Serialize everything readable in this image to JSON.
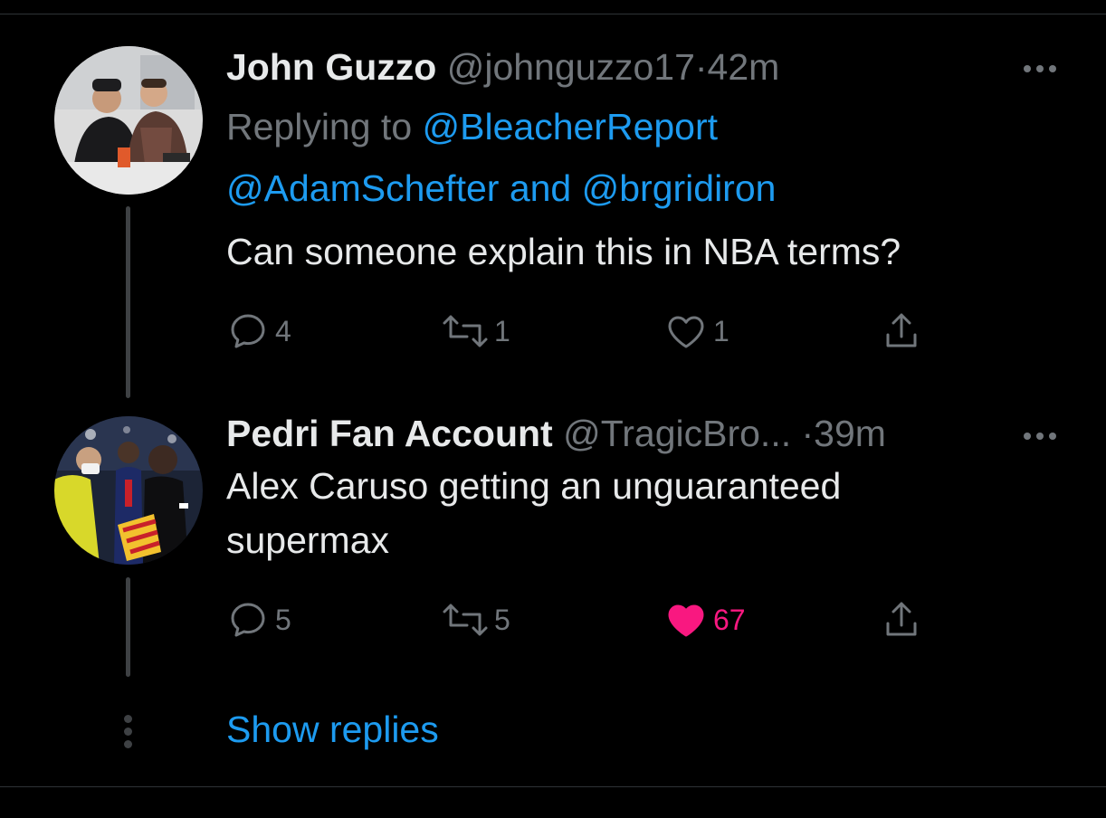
{
  "tweets": [
    {
      "name": "John Guzzo",
      "handle": "@johnguzzo17",
      "sep": "·",
      "time": "42m",
      "replying_prefix": "Replying to ",
      "replying_to_1": "@BleacherReport",
      "replying_to_2": "@AdamSchefter",
      "replying_and": " and ",
      "replying_to_3": "@brgridiron",
      "text": "Can someone explain this in NBA terms?",
      "replies": "4",
      "retweets": "1",
      "likes": "1",
      "liked": false
    },
    {
      "name": "Pedri Fan Account",
      "handle": "@TragicBro...",
      "sep": "·",
      "time": "39m",
      "text_line_1": "Alex Caruso getting an unguaranteed",
      "text_line_2": "supermax",
      "replies": "5",
      "retweets": "5",
      "likes": "67",
      "liked": true
    }
  ],
  "show_replies": "Show replies",
  "colors": {
    "background": "#000000",
    "text": "#e7e9ea",
    "muted": "#71767b",
    "link": "#1d9bf0",
    "like": "#f91880"
  },
  "icons": [
    "reply-icon",
    "retweet-icon",
    "like-icon",
    "share-icon",
    "more-icon"
  ]
}
